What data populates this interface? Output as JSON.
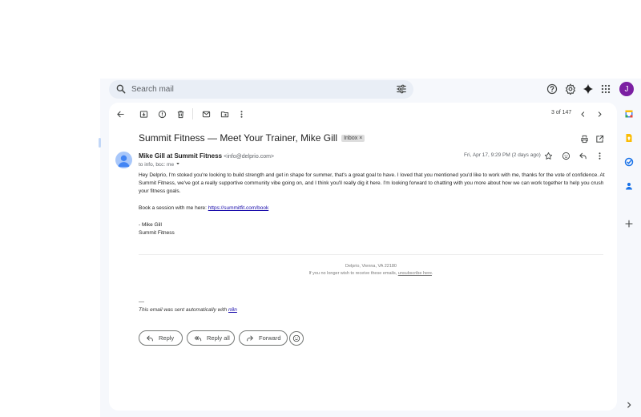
{
  "search": {
    "placeholder": "Search mail"
  },
  "header": {
    "avatar_letter": "J"
  },
  "toolbar": {
    "pager": "3 of 147"
  },
  "email": {
    "subject": "Summit Fitness — Meet Your Trainer, Mike Gill",
    "label": "Inbox",
    "label_remove": "×",
    "sender_name": "Mike Gill at Summit Fitness",
    "sender_email": "<info@delprio.com>",
    "to_line": "to info, bcc: me",
    "date": "Fri, Apr 17, 9:29 PM (2 days ago)",
    "body_paragraph": "Hey Delprio, I'm stoked you're looking to build strength and get in shape for summer, that's a great goal to have. I loved that you mentioned you'd like to work with me, thanks for the vote of confidence. At Summit Fitness, we've got a really supportive community vibe going on, and I think you'll really dig it here. I'm looking forward to chatting with you more about how we can work together to help you crush your fitness goals.",
    "book_prefix": "Book a session with me here: ",
    "book_link": "https://summitfit.com/book",
    "signature_1": "- Mike Gill",
    "signature_2": "Summit Fitness",
    "footer_address": "Delprio, Vienna, VA 22180",
    "footer_unsub_prefix": "If you no longer wish to receive these emails, ",
    "footer_unsub_link": "unsubscribe here",
    "footer_unsub_suffix": ".",
    "dashes": "—",
    "auto_note_prefix": "This email was sent automatically with ",
    "auto_note_link": "n8n"
  },
  "actions": {
    "reply": "Reply",
    "reply_all": "Reply all",
    "forward": "Forward"
  },
  "colors": {
    "avatar": "#7b1fa2",
    "app_bg": "#f6f8fc",
    "search_bg": "#e9eef6",
    "link": "#1a0dab"
  }
}
